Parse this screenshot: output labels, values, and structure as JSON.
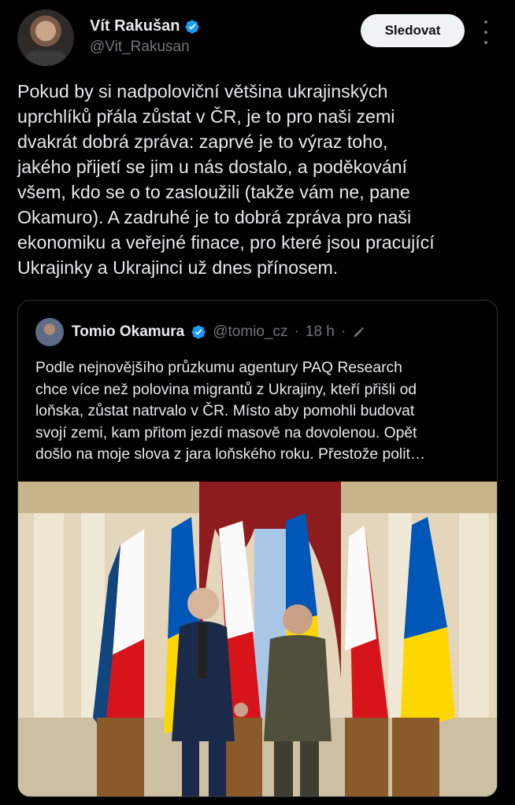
{
  "author": {
    "display_name": "Vít Rakušan",
    "handle": "@Vit_Rakusan",
    "follow_label": "Sledovat"
  },
  "tweet": {
    "text": "Pokud by si nadpoloviční většina ukrajinských\nuprchlíků přála zůstat v ČR, je to pro naši zemi\ndvakrát dobrá zpráva: zaprvé je to výraz toho,\njakého přijetí se jim u nás dostalo, a poděkování\nvšem, kdo se o to zasloužili (takže vám ne, pane\nOkamuro). A zadruhé je to dobrá zpráva pro naši\nekonomiku a veřejné finace, pro které jsou pracující\nUkrajinky a Ukrajinci už dnes přínosem."
  },
  "quote": {
    "display_name": "Tomio Okamura",
    "handle": "@tomio_cz",
    "separator": "·",
    "time": "18 h",
    "text": "Podle nejnovějšího průzkumu agentury PAQ Research\nchce více než polovina migrantů z Ukrajiny, kteří přišli od\nloňska, zůstat natrvalo v ČR. Místo aby pomohli budovat\nsvojí zemi, kam přitom jezdí masově na dovolenou. Opět\ndošlo na moje slova z jara loňského roku. Přestože polit…"
  },
  "icons": {
    "verified": "verified-badge-icon",
    "more": "more-options-icon",
    "edit": "edited-pencil-icon"
  },
  "colors": {
    "background": "#000000",
    "text": "#e7e9ea",
    "secondary": "#71767b",
    "verified_blue": "#1d9bf0",
    "button_bg": "#eff3f4"
  }
}
